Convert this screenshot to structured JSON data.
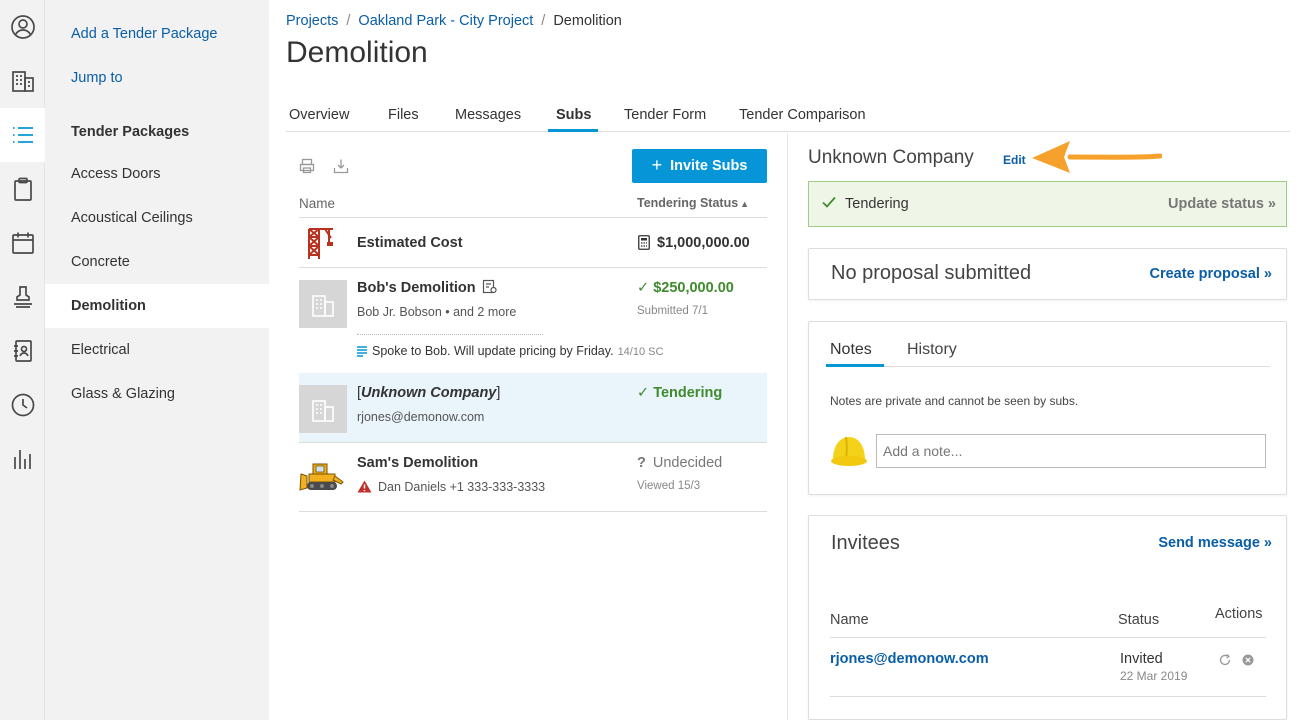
{
  "rail": {
    "icons": [
      "profile-icon",
      "building-icon",
      "list-icon",
      "clipboard-icon",
      "calendar-icon",
      "stamp-icon",
      "address-book-icon",
      "clock-icon",
      "bar-chart-icon"
    ],
    "active": "list-icon"
  },
  "sidebar": {
    "add_link": "Add a Tender Package",
    "jump_link": "Jump to",
    "heading": "Tender Packages",
    "items": [
      "Access Doors",
      "Acoustical Ceilings",
      "Concrete",
      "Demolition",
      "Electrical",
      "Glass & Glazing"
    ],
    "active_item": "Demolition"
  },
  "breadcrumb": {
    "projects": "Projects",
    "project": "Oakland Park - City Project",
    "current": "Demolition"
  },
  "page_title": "Demolition",
  "tabs": [
    "Overview",
    "Files",
    "Messages",
    "Subs",
    "Tender Form",
    "Tender Comparison"
  ],
  "active_tab": "Subs",
  "subs_list": {
    "invite_label": "Invite Subs",
    "col_name": "Name",
    "col_status": "Tendering Status",
    "estimated": {
      "label": "Estimated Cost",
      "value": "$1,000,000.00"
    },
    "rows": [
      {
        "name": "Bob's Demolition",
        "contact": "Bob Jr. Bobson • and 2 more",
        "status": "$250,000.00",
        "meta": "Submitted 7/1",
        "note": "Spoke to Bob. Will update pricing by Friday.",
        "note_meta": "14/10 SC"
      },
      {
        "name_prefix": "[",
        "name": "Unknown Company",
        "name_suffix": "]",
        "contact": "rjones@demonow.com",
        "status": "Tendering"
      },
      {
        "name": "Sam's Demolition",
        "contact": "Dan Daniels +1 333-333-3333",
        "status": "Undecided",
        "meta": "Viewed 15/3"
      }
    ]
  },
  "detail": {
    "company": "Unknown Company",
    "edit_label": "Edit",
    "status": "Tendering",
    "update_label": "Update status »",
    "proposal_title": "No proposal submitted",
    "create_proposal": "Create proposal »",
    "notes_tab": "Notes",
    "history_tab": "History",
    "notes_hint": "Notes are private and cannot be seen by subs.",
    "note_placeholder": "Add a note...",
    "invitees_title": "Invitees",
    "send_message": "Send message »",
    "inv_col_name": "Name",
    "inv_col_status": "Status",
    "inv_col_actions": "Actions",
    "invitee": {
      "email": "rjones@demonow.com",
      "status": "Invited",
      "date": "22 Mar 2019"
    }
  },
  "colors": {
    "accent": "#0696d7",
    "link": "#0a5ea8",
    "success": "#3f8b2e",
    "annotation_arrow": "#f5a12b"
  }
}
